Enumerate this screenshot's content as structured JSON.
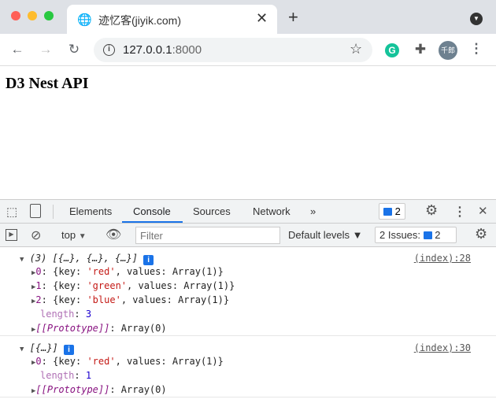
{
  "browser": {
    "tab_title": "迹忆客(jiyik.com)",
    "url_host": "127.0.0.1",
    "url_port": ":8000",
    "avatar_text": "千郎"
  },
  "page": {
    "heading": "D3 Nest API"
  },
  "devtools": {
    "tabs": [
      "Elements",
      "Console",
      "Sources",
      "Network"
    ],
    "active_tab": "Console",
    "more": "»",
    "message_count": "2",
    "context": "top",
    "filter_placeholder": "Filter",
    "levels": "Default levels ▼",
    "issues_label": "2 Issues:",
    "issues_count": "2"
  },
  "console": {
    "groups": [
      {
        "summary": "(3) [{…}, {…}, {…}]",
        "source": "(index):28",
        "items": [
          {
            "idx": "0",
            "key": "'red'"
          },
          {
            "idx": "1",
            "key": "'green'"
          },
          {
            "idx": "2",
            "key": "'blue'"
          }
        ],
        "length": "3"
      },
      {
        "summary": "[{…}]",
        "source": "(index):30",
        "items": [
          {
            "idx": "0",
            "key": "'red'"
          }
        ],
        "length": "1"
      }
    ],
    "values_text": "values: Array(1)}",
    "prototype_label": "[[Prototype]]",
    "prototype_value": ": Array(0)"
  }
}
